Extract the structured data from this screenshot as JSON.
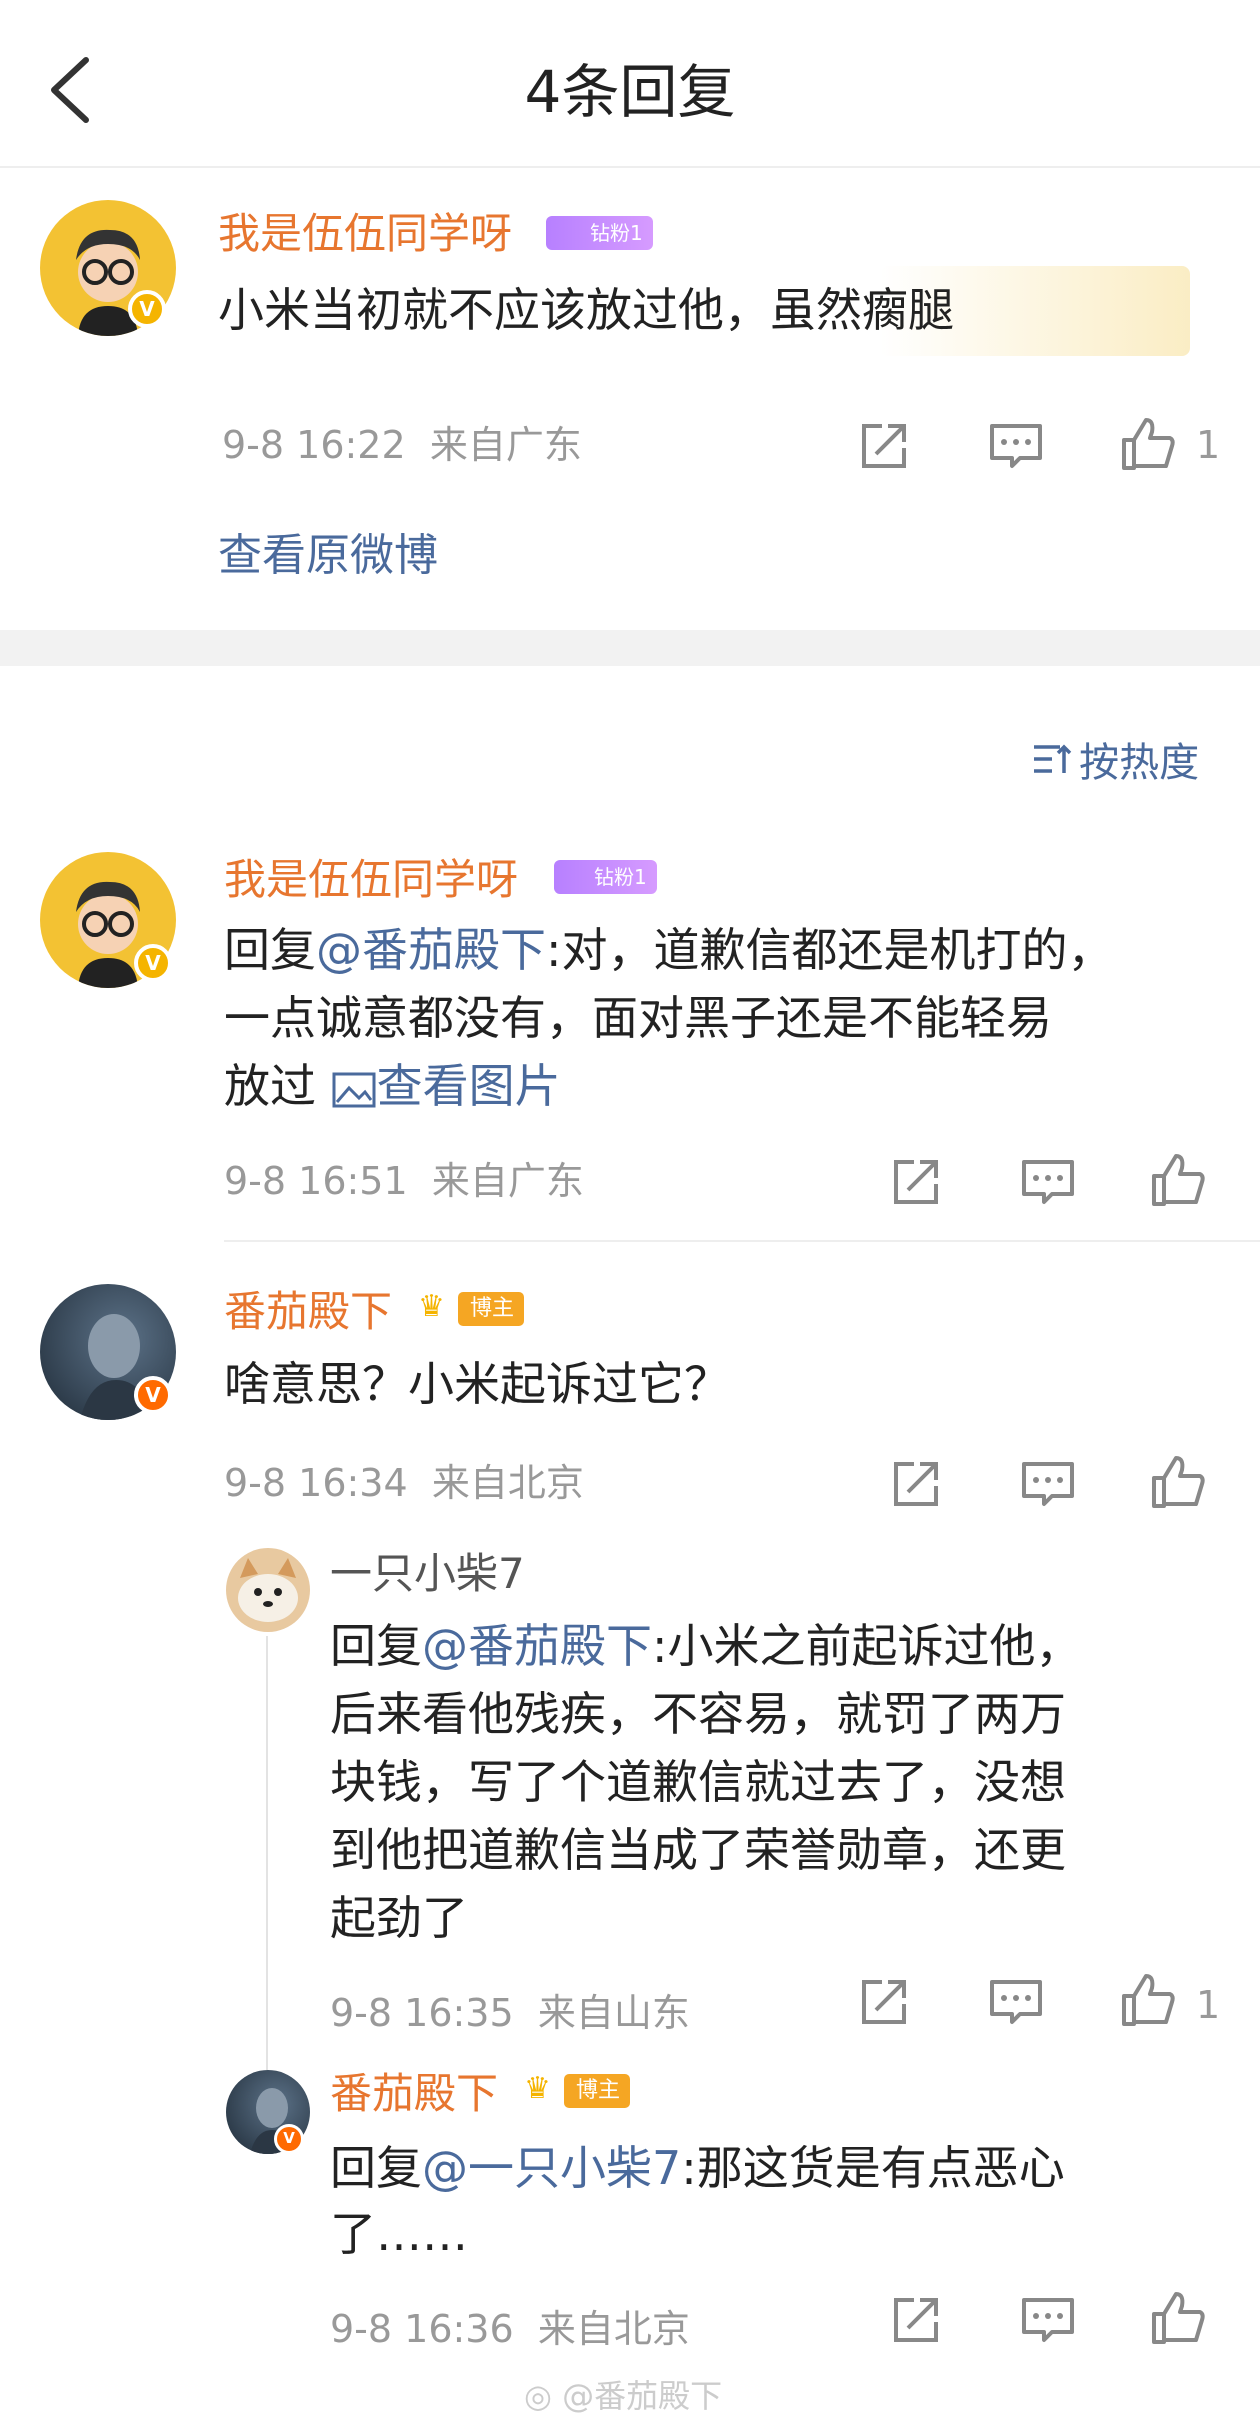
{
  "header": {
    "title": "4条回复"
  },
  "main_comment": {
    "username": "我是伍伍同学呀",
    "fan_badge": "钻粉1",
    "text": "小米当初就不应该放过他，虽然瘸腿",
    "time": "9-8 16:22",
    "location": "来自广东",
    "likes": "1",
    "view_original": "查看原微博"
  },
  "sort": {
    "label": "按热度"
  },
  "replies": [
    {
      "username": "我是伍伍同学呀",
      "fan_badge": "钻粉1",
      "reply_prefix": "回复",
      "mention": "@番茄殿下",
      "line1": ":对，道歉信都还是机打的，",
      "line2": "一点诚意都没有，面对黑子还是不能轻易",
      "line3": "放过",
      "view_image": "查看图片",
      "time": "9-8 16:51",
      "location": "来自广东"
    },
    {
      "username": "番茄殿下",
      "role_badge": "博主",
      "text": "啥意思？小米起诉过它？",
      "time": "9-8 16:34",
      "location": "来自北京",
      "sub": [
        {
          "username": "一只小柴7",
          "reply_prefix": "回复",
          "mention": "@番茄殿下",
          "line1": ":小米之前起诉过他，",
          "line2": "后来看他残疾，不容易，就罚了两万",
          "line3": "块钱，写了个道歉信就过去了，没想",
          "line4": "到他把道歉信当成了荣誉勋章，还更",
          "line5": "起劲了",
          "time": "9-8 16:35",
          "location": "来自山东",
          "likes": "1"
        },
        {
          "username": "番茄殿下",
          "role_badge": "博主",
          "reply_prefix": "回复",
          "mention": "@一只小柴7",
          "line1": ":那这货是有点恶心",
          "line2": "了……",
          "time": "9-8 16:36",
          "location": "来自北京"
        }
      ]
    }
  ],
  "watermark": "@番茄殿下",
  "colors": {
    "username": "#e7762f",
    "link": "#4a6a9c",
    "meta": "#999999"
  }
}
